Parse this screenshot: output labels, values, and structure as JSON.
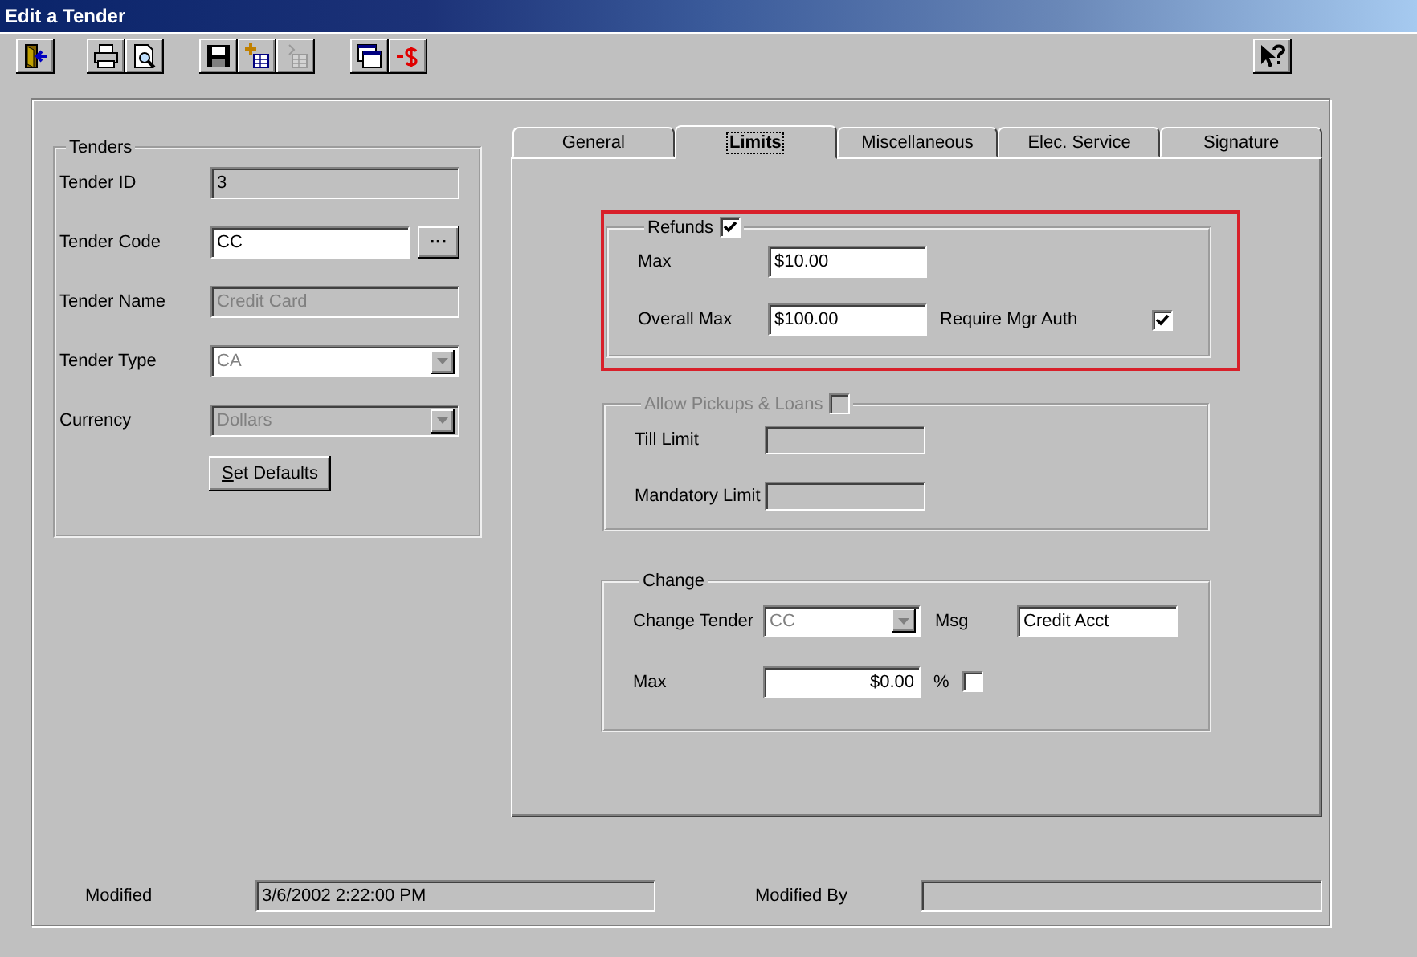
{
  "window": {
    "title": "Edit a Tender"
  },
  "toolbar": {
    "buttons": [
      {
        "disabled": false
      },
      {
        "disabled": false
      },
      {
        "disabled": false
      },
      {
        "disabled": false
      },
      {
        "disabled": false
      },
      {
        "disabled": true
      },
      {
        "disabled": false
      },
      {
        "disabled": false
      },
      {
        "disabled": false
      }
    ]
  },
  "tenders": {
    "title": "Tenders",
    "fields": [
      {
        "label": "Tender ID",
        "value": "3",
        "kind": "text",
        "editable": false,
        "disabled": false
      },
      {
        "label": "Tender Code",
        "value": "CC",
        "kind": "lookup",
        "editable": true,
        "disabled": false,
        "button": "···"
      },
      {
        "label": "Tender Name",
        "value": "Credit Card",
        "kind": "text",
        "editable": false,
        "disabled": true
      },
      {
        "label": "Tender Type",
        "value": "CA",
        "kind": "combo",
        "editable": true,
        "disabled": true
      },
      {
        "label": "Currency",
        "value": "Dollars",
        "kind": "combo",
        "editable": false,
        "disabled": true
      }
    ],
    "set_defaults": {
      "label": "Set Defaults",
      "mnemonic_first": true
    }
  },
  "tabs": [
    {
      "label": "General",
      "selected": false
    },
    {
      "label": "Limits",
      "selected": true
    },
    {
      "label": "Miscellaneous",
      "selected": false
    },
    {
      "label": "Elec. Service",
      "selected": false
    },
    {
      "label": "Signature",
      "selected": false
    }
  ],
  "refunds": {
    "title": "Refunds",
    "checked": true,
    "highlighted": true,
    "max": {
      "label": "Max",
      "value": "$10.00"
    },
    "overall_max": {
      "label": "Overall Max",
      "value": "$100.00"
    },
    "require_mgr_auth": {
      "label": "Require Mgr Auth",
      "checked": true
    }
  },
  "pickups": {
    "title": "Allow Pickups & Loans",
    "checked": false,
    "disabled": true,
    "till_limit": {
      "label": "Till Limit"
    },
    "mandatory_limit": {
      "label": "Mandatory Limit"
    }
  },
  "change": {
    "title": "Change",
    "change_tender": {
      "label": "Change Tender",
      "value": "CC",
      "disabled": true
    },
    "msg": {
      "label": "Msg",
      "value": "Credit Acct"
    },
    "max": {
      "label": "Max",
      "value": "$0.00"
    },
    "percent": {
      "label": "%",
      "checked": false
    }
  },
  "footer": {
    "modified": {
      "label": "Modified",
      "value": "3/6/2002 2:22:00 PM"
    },
    "modified_by": {
      "label": "Modified By"
    }
  }
}
